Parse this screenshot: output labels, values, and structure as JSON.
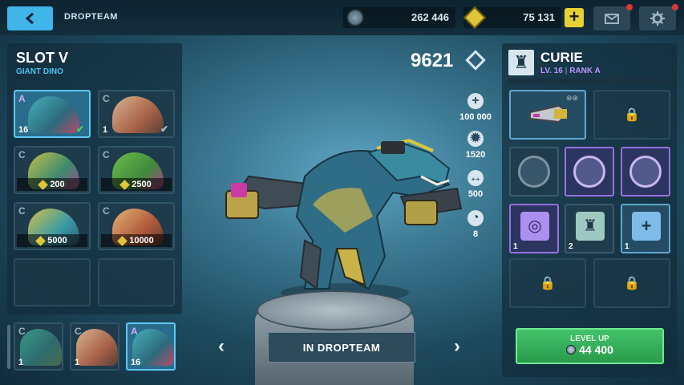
{
  "header": {
    "title": "DROPTEAM",
    "coins": "262 446",
    "gems": "75 131",
    "buy_label": "+"
  },
  "slot": {
    "title": "SLOT V",
    "subtitle": "GIANT DINO",
    "cards": [
      {
        "rank": "A",
        "level": "16",
        "selected": true,
        "equipped": true
      },
      {
        "rank": "C",
        "level": "1",
        "selected": false,
        "equipped": true
      },
      {
        "rank": "C",
        "price": "200"
      },
      {
        "rank": "C",
        "price": "2500"
      },
      {
        "rank": "C",
        "price": "5000"
      },
      {
        "rank": "C",
        "price": "10000"
      }
    ],
    "dropteam": [
      {
        "rank": "C",
        "level": "1"
      },
      {
        "rank": "C",
        "level": "1"
      },
      {
        "rank": "A",
        "level": "16"
      }
    ]
  },
  "robot": {
    "power": "9621",
    "stats": [
      {
        "icon": "health-icon",
        "value": "100 000"
      },
      {
        "icon": "gear-icon",
        "value": "1520"
      },
      {
        "icon": "speed-icon",
        "value": "500"
      },
      {
        "icon": "gauge-icon",
        "value": "8"
      }
    ],
    "status_label": "IN DROPTEAM"
  },
  "pilot": {
    "name": "CURIE",
    "level": "LV. 16",
    "rank": "RANK A",
    "module_counts": [
      "1",
      "2",
      "1"
    ],
    "level_up_label": "LEVEL UP",
    "level_up_price": "44 400"
  },
  "colors": {
    "accent": "#3fb5e9",
    "green": "#43d664",
    "purple": "#b897ff",
    "gold": "#e0c53a"
  }
}
